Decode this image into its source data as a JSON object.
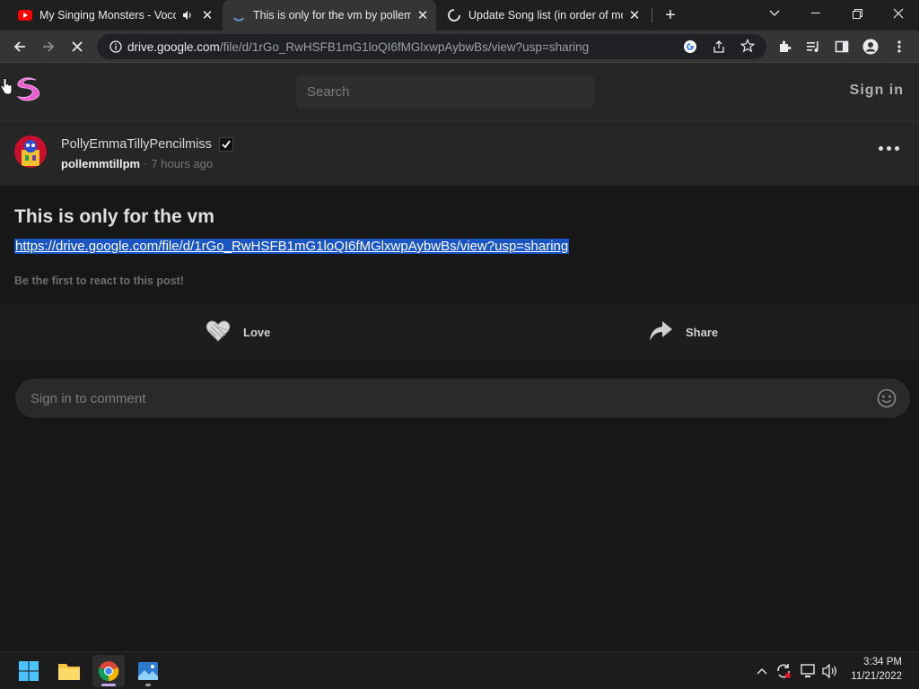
{
  "browser": {
    "tabs": [
      {
        "title": "My Singing Monsters - Voco",
        "icon": "youtube-icon",
        "audio": "speaker-icon"
      },
      {
        "title": "This is only for the vm by pollem",
        "icon": "loading-spinner-icon"
      },
      {
        "title": "Update Song list (in order of mo",
        "icon": "loading-icon"
      }
    ],
    "url_host": "drive.google.com",
    "url_path": "/file/d/1rGo_RwHSFB1mG1loQI6fMGlxwpAybwBs/view?usp=sharing"
  },
  "site": {
    "search_placeholder": "Search",
    "sign_in_label": "Sign in"
  },
  "post": {
    "display_name": "PollyEmmaTillyPencilmiss",
    "username": "pollemmtillpm",
    "separator": "·",
    "time": "7 hours ago",
    "title": "This is only for the vm",
    "link": "https://drive.google.com/file/d/1rGo_RwHSFB1mG1loQI6fMGlxwpAybwBs/view?usp=sharing",
    "react_note": "Be the first to react to this post!",
    "love_label": "Love",
    "share_label": "Share",
    "comment_placeholder": "Sign in to comment"
  },
  "taskbar": {
    "time": "3:34 PM",
    "date": "11/21/2022"
  },
  "colors": {
    "accent_link_highlight": "#1a55c4",
    "logo_pink": "#e85bd1",
    "background": "#171717"
  }
}
